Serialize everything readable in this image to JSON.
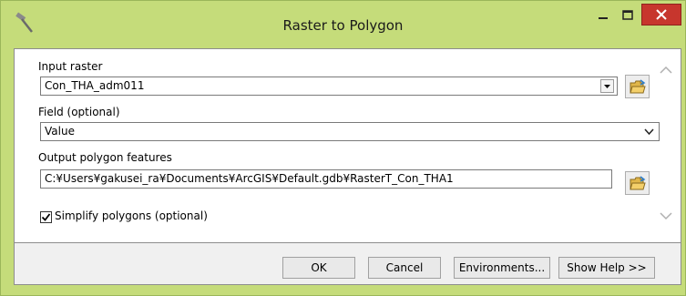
{
  "window": {
    "title": "Raster to Polygon",
    "icon": "hammer-icon"
  },
  "form": {
    "input_raster": {
      "label": "Input raster",
      "value": "Con_THA_adm011"
    },
    "field": {
      "label": "Field (optional)",
      "value": "Value"
    },
    "output_features": {
      "label": "Output polygon features",
      "value": "C:¥Users¥gakusei_ra¥Documents¥ArcGIS¥Default.gdb¥RasterT_Con_THA1"
    },
    "simplify": {
      "label": "Simplify polygons (optional)",
      "checked": true
    }
  },
  "buttons": {
    "ok": "OK",
    "cancel": "Cancel",
    "environments": "Environments...",
    "show_help": "Show Help >>"
  },
  "colors": {
    "frame": "#c5dc7a",
    "close_button": "#c7362d"
  }
}
